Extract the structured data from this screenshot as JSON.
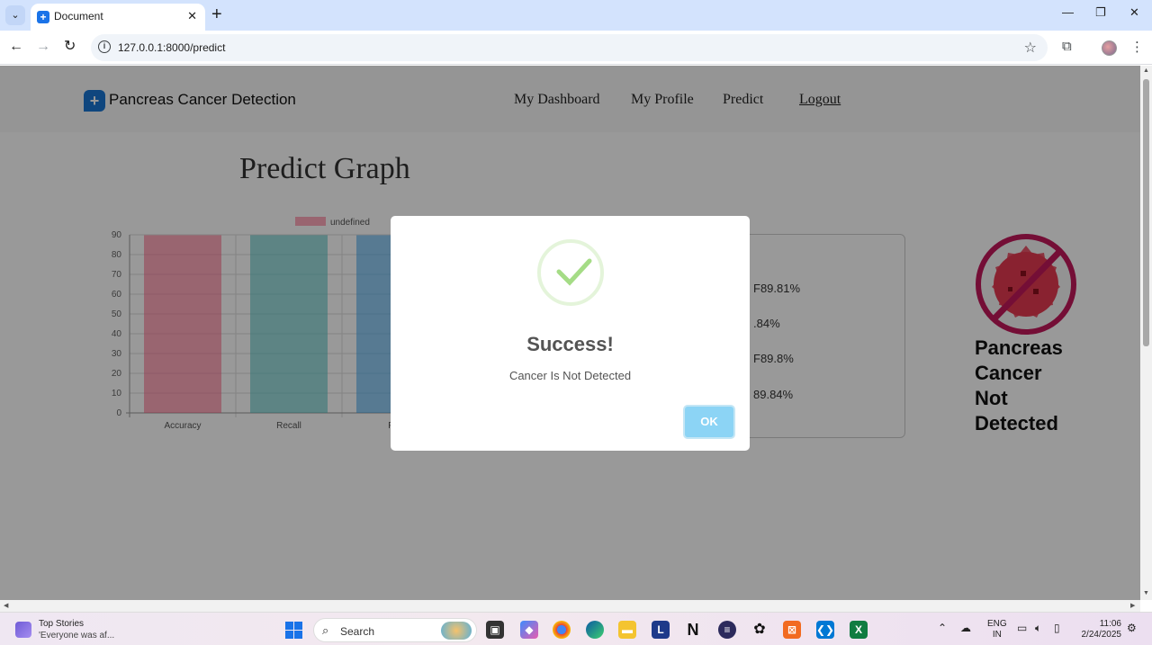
{
  "browser": {
    "tab_title": "Document",
    "url": "127.0.0.1:8000/predict"
  },
  "site": {
    "brand": "Pancreas Cancer Detection",
    "nav": [
      "My Dashboard",
      "My Profile",
      "Predict",
      "Logout"
    ]
  },
  "page": {
    "title": "Predict Graph",
    "metrics": [
      "Accuracy: 89.81%",
      "Recall: 89.84%",
      "Precision: 89.8%",
      "F1 Score: 89.84%"
    ],
    "metrics_visible": [
      "F89.81%",
      ".84%",
      "F89.8%",
      "89.84%"
    ],
    "result_label": "Pancreas Cancer Not Detected",
    "result_lines": [
      "Pancreas",
      "Cancer",
      "Not",
      "Detected"
    ]
  },
  "chart_data": {
    "type": "bar",
    "legend": "undefined",
    "categories": [
      "Accuracy",
      "Recall",
      "Precision"
    ],
    "visible_tick_labels": [
      "Accuracy",
      "Recall",
      "Pre"
    ],
    "values": [
      89.81,
      89.84,
      89.8
    ],
    "colors": [
      "#ff6384",
      "#4bc0c0",
      "#36a2eb"
    ],
    "ylim": [
      0,
      90
    ],
    "yticks": [
      0,
      10,
      20,
      30,
      40,
      50,
      60,
      70,
      80,
      90
    ],
    "grid": true
  },
  "modal": {
    "title": "Success!",
    "text": "Cancer Is Not Detected",
    "ok_label": "OK"
  },
  "taskbar": {
    "news_title": "Top Stories",
    "news_sub": "'Everyone was af...",
    "search_label": "Search",
    "lang_top": "ENG",
    "lang_bottom": "IN",
    "time": "11:06",
    "date": "2/24/2025"
  }
}
